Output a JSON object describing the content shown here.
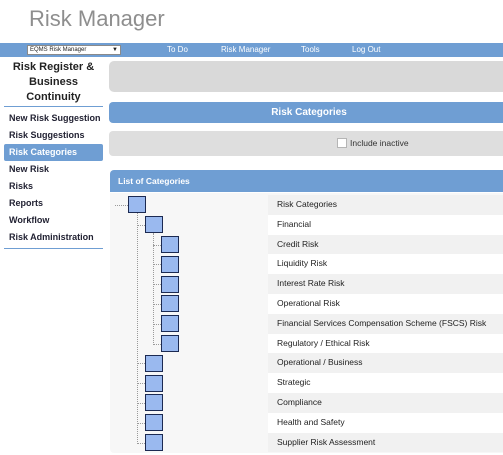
{
  "app": {
    "title": "Risk Manager"
  },
  "topnav": {
    "selector_value": "EQMS Risk Manager",
    "links": [
      "To Do",
      "Risk Manager",
      "Tools",
      "Log Out"
    ]
  },
  "sidebar": {
    "section_title": "Risk Register & Business Continuity",
    "items": [
      {
        "label": "New Risk Suggestion"
      },
      {
        "label": "Risk Suggestions"
      },
      {
        "label": "Risk Categories",
        "active": true
      },
      {
        "label": "New Risk"
      },
      {
        "label": "Risks"
      },
      {
        "label": "Reports"
      },
      {
        "label": "Workflow"
      },
      {
        "label": "Risk Administration"
      }
    ]
  },
  "main": {
    "header": "Risk Categories",
    "filter": {
      "include_inactive_label": "Include inactive",
      "include_inactive_checked": false
    },
    "list_header": "List of Categories",
    "tree": [
      {
        "label": "Risk Categories",
        "level": 0
      },
      {
        "label": "Financial",
        "level": 1
      },
      {
        "label": "Credit Risk",
        "level": 2
      },
      {
        "label": "Liquidity Risk",
        "level": 2
      },
      {
        "label": "Interest Rate Risk",
        "level": 2
      },
      {
        "label": "Operational Risk",
        "level": 2
      },
      {
        "label": "Financial Services Compensation Scheme (FSCS) Risk",
        "level": 2
      },
      {
        "label": "Regulatory / Ethical Risk",
        "level": 2
      },
      {
        "label": "Operational / Business",
        "level": 1
      },
      {
        "label": "Strategic",
        "level": 1
      },
      {
        "label": "Compliance",
        "level": 1
      },
      {
        "label": "Health and Safety",
        "level": 1
      },
      {
        "label": "Supplier Risk Assessment",
        "level": 1
      }
    ]
  },
  "colors": {
    "accent": "#6f9ed3",
    "node_fill": "#9ab9ef",
    "node_border": "#1c2a52"
  },
  "icons": {
    "dropdown": "chevron-down-icon",
    "checkbox": "checkbox-icon",
    "tree_node": "tree-node-icon"
  }
}
